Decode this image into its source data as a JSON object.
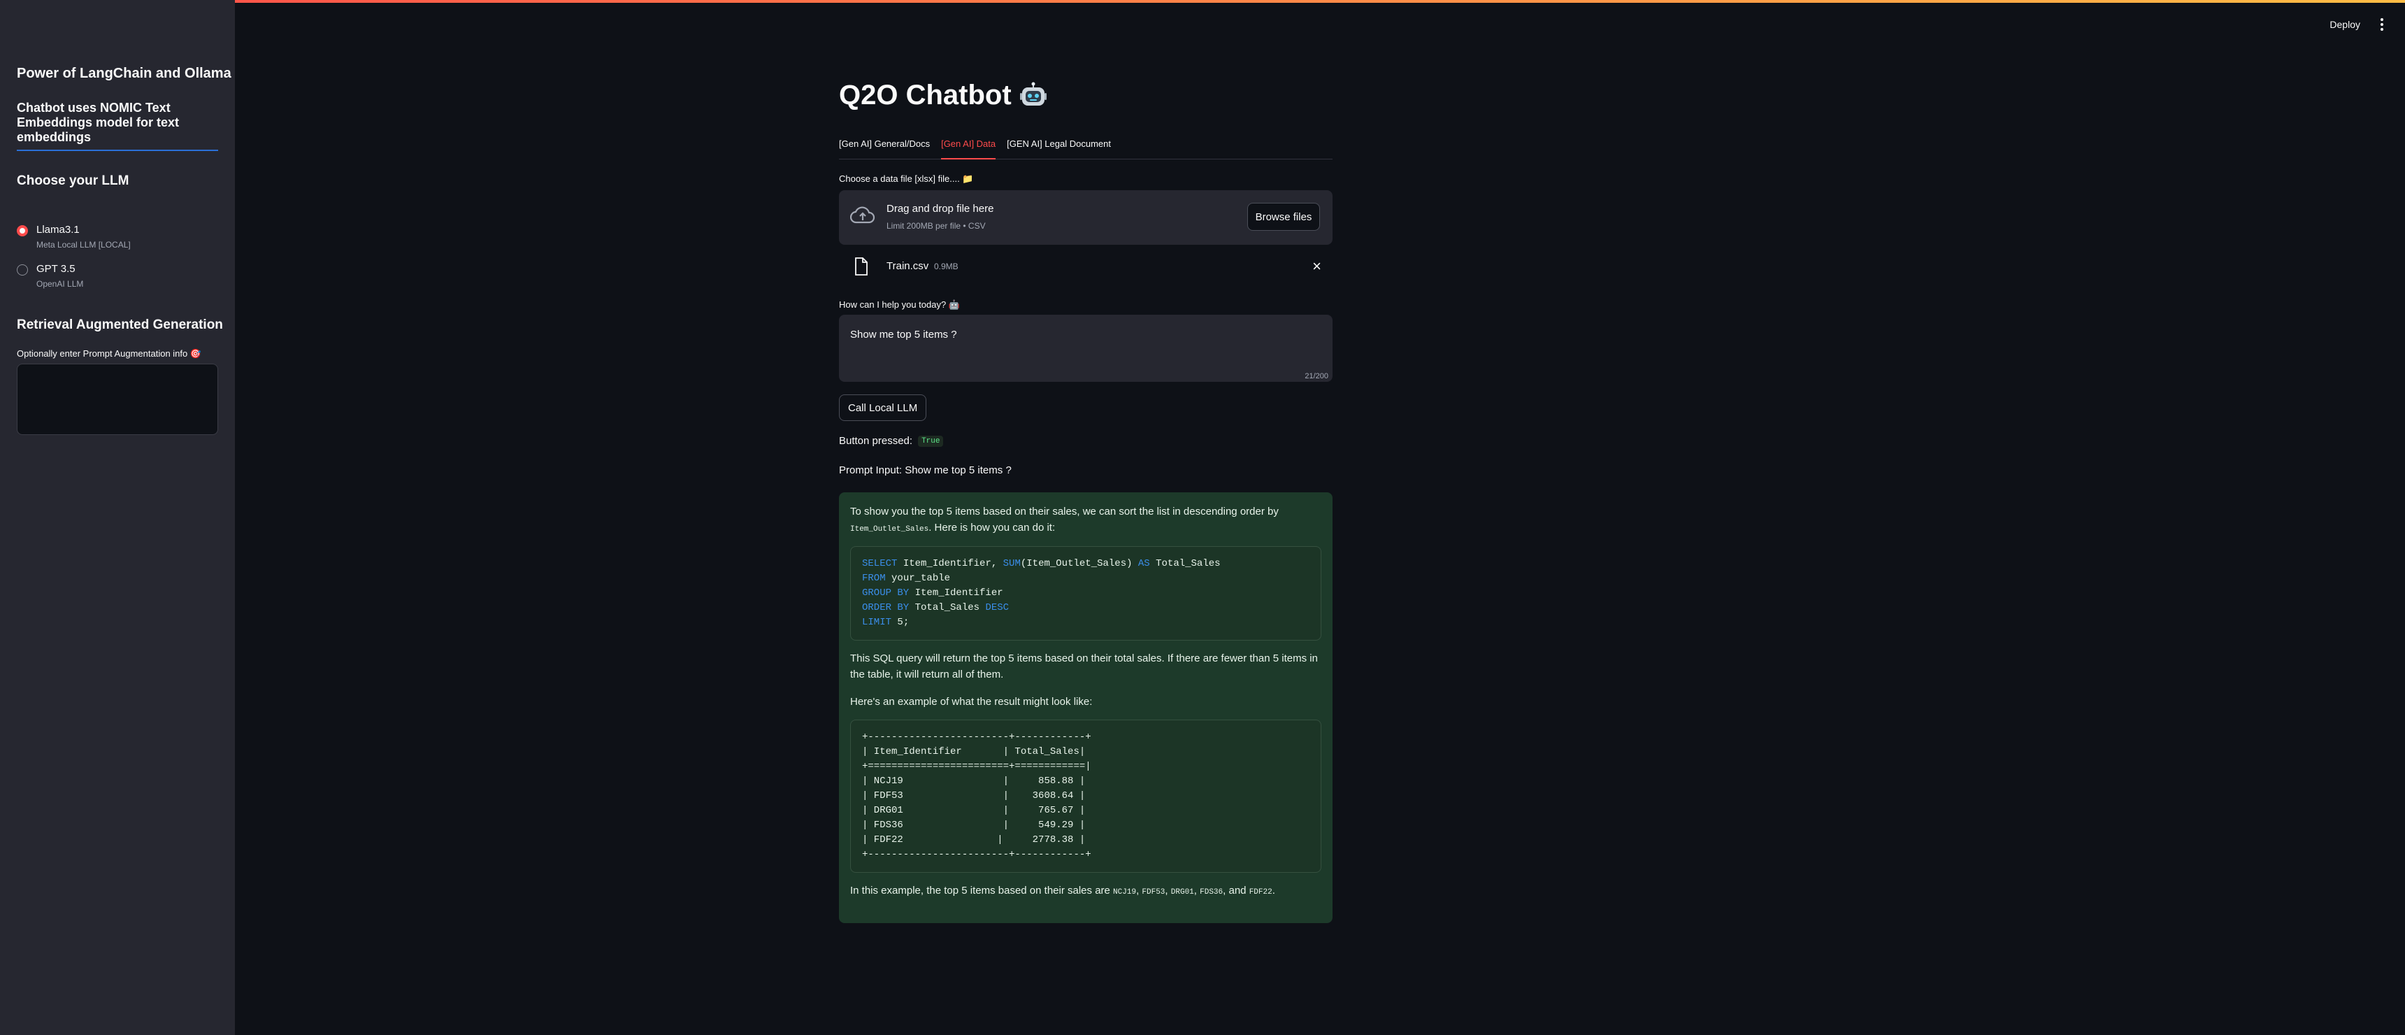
{
  "app": {
    "deploy_label": "Deploy"
  },
  "sidebar": {
    "title": "Power of LangChain and Ollama",
    "subtitle": "Chatbot uses NOMIC Text Embeddings model for text embeddings",
    "llm_heading": "Choose your LLM",
    "options": [
      {
        "label": "Llama3.1",
        "caption": "Meta Local LLM [LOCAL]",
        "selected": true
      },
      {
        "label": "GPT 3.5",
        "caption": "OpenAI LLM",
        "selected": false
      }
    ],
    "rag_heading": "Retrieval Augmented Generation",
    "augment_label": "Optionally enter Prompt Augmentation info 🎯",
    "augment_value": ""
  },
  "main": {
    "title": "Q2O Chatbot",
    "tabs": [
      {
        "label": "[Gen AI] General/Docs",
        "active": false
      },
      {
        "label": "[Gen AI] Data",
        "active": true
      },
      {
        "label": "[GEN AI] Legal Document",
        "active": false
      }
    ],
    "uploader": {
      "label": "Choose a data file [xlsx] file.... 📁",
      "drop_text": "Drag and drop file here",
      "limit_text": "Limit 200MB per file • CSV",
      "browse_label": "Browse files"
    },
    "file": {
      "name": "Train.csv",
      "size": "0.9MB"
    },
    "prompt": {
      "label": "How can I help you today? 🤖",
      "value": "Show me top 5 items ?",
      "counter": "21/200"
    },
    "call_button": "Call Local LLM",
    "pressed_label": "Button pressed:",
    "pressed_value": "True",
    "prompt_input_line": "Prompt Input: Show me top 5 items ?",
    "answer": {
      "p1_before": "To show you the top 5 items based on their sales, we can sort the list in descending order by",
      "p1_code": "Item_Outlet_Sales",
      "p1_after": ". Here is how you can do it:",
      "sql_lines": [
        "SELECT Item_Identifier, SUM(Item_Outlet_Sales) AS Total_Sales",
        "FROM your_table",
        "GROUP BY Item_Identifier",
        "ORDER BY Total_Sales DESC",
        "LIMIT 5;"
      ],
      "p2": "This SQL query will return the top 5 items based on their total sales. If there are fewer than 5 items in the table, it will return all of them.",
      "p3": "Here's an example of what the result might look like:",
      "table_text": "+------------------------+------------+\n| Item_Identifier       | Total_Sales|\n+========================+============|\n| NCJ19                 |     858.88 |\n| FDF53                 |    3608.64 |\n| DRG01                 |     765.67 |\n| FDS36                 |     549.29 |\n| FDF22                |     2778.38 |\n+------------------------+------------+",
      "p4_before": "In this example, the top 5 items based on their sales are",
      "p4_items": [
        "NCJ19",
        "FDF53",
        "DRG01",
        "FDS36"
      ],
      "p4_and": "and",
      "p4_last": "FDF22"
    }
  }
}
